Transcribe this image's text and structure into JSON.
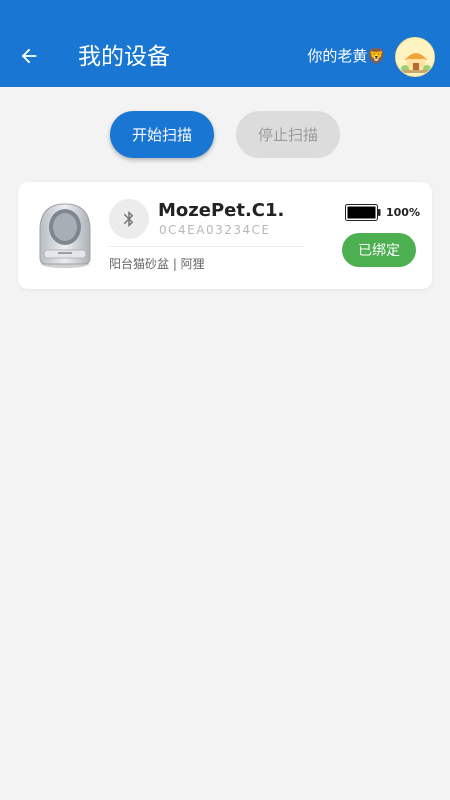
{
  "header": {
    "title": "我的设备",
    "user_name": "你的老黄🦁",
    "back_icon": "arrow-left-icon",
    "background": "#1976d2"
  },
  "scan": {
    "start_label": "开始扫描",
    "stop_label": "停止扫描"
  },
  "device": {
    "name": "MozePet.C1.",
    "mac": "0C4EA03234CE",
    "description": "阳台猫砂盆 | 阿狸",
    "battery_percent": "100%",
    "battery_level": 1.0,
    "bound_label": "已绑定",
    "connection_icon": "bluetooth-icon",
    "bound_color": "#4caf50"
  }
}
